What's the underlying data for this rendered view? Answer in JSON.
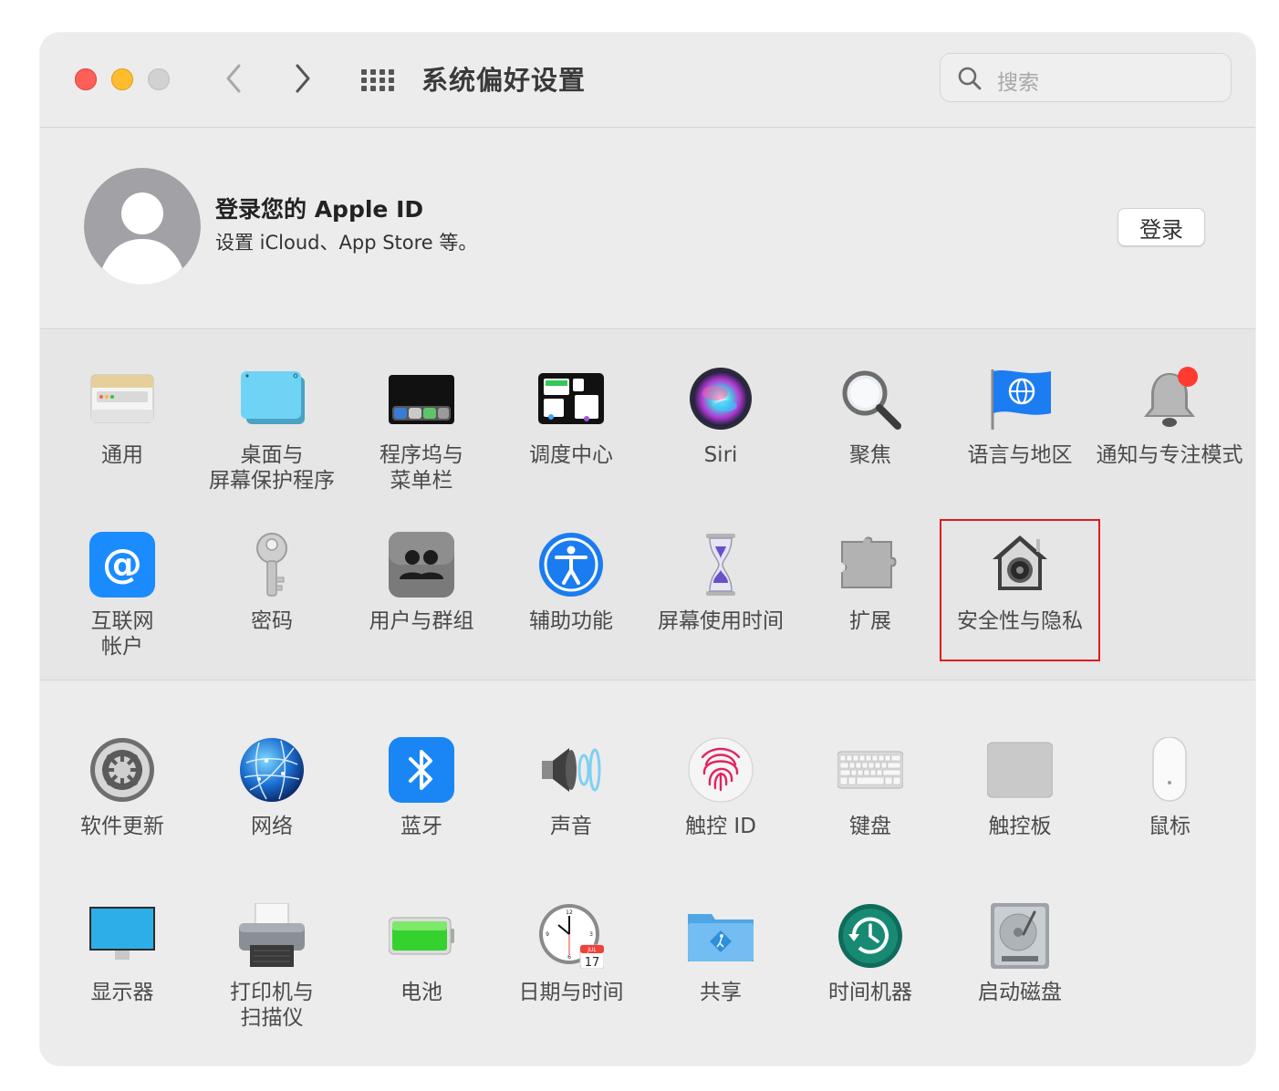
{
  "window": {
    "title": "系统偏好设置",
    "search_placeholder": "搜索"
  },
  "account": {
    "title": "登录您的 Apple ID",
    "subtitle": "设置 iCloud、App Store 等。",
    "login_button": "登录"
  },
  "panes_row1": [
    {
      "label": "通用",
      "icon": "general-icon"
    },
    {
      "label": "桌面与\n屏幕保护程序",
      "icon": "desktop-screensaver-icon"
    },
    {
      "label": "程序坞与\n菜单栏",
      "icon": "dock-menubar-icon"
    },
    {
      "label": "调度中心",
      "icon": "mission-control-icon"
    },
    {
      "label": "Siri",
      "icon": "siri-icon"
    },
    {
      "label": "聚焦",
      "icon": "spotlight-icon"
    },
    {
      "label": "语言与地区",
      "icon": "language-region-icon"
    },
    {
      "label": "通知与专注模式",
      "icon": "notifications-icon"
    }
  ],
  "panes_row2": [
    {
      "label": "互联网\n帐户",
      "icon": "internet-accounts-icon"
    },
    {
      "label": "密码",
      "icon": "passwords-icon"
    },
    {
      "label": "用户与群组",
      "icon": "users-groups-icon"
    },
    {
      "label": "辅助功能",
      "icon": "accessibility-icon"
    },
    {
      "label": "屏幕使用时间",
      "icon": "screen-time-icon"
    },
    {
      "label": "扩展",
      "icon": "extensions-icon"
    },
    {
      "label": "安全性与隐私",
      "icon": "security-privacy-icon"
    }
  ],
  "panes_row3": [
    {
      "label": "软件更新",
      "icon": "software-update-icon"
    },
    {
      "label": "网络",
      "icon": "network-icon"
    },
    {
      "label": "蓝牙",
      "icon": "bluetooth-icon"
    },
    {
      "label": "声音",
      "icon": "sound-icon"
    },
    {
      "label": "触控 ID",
      "icon": "touch-id-icon"
    },
    {
      "label": "键盘",
      "icon": "keyboard-icon"
    },
    {
      "label": "触控板",
      "icon": "trackpad-icon"
    },
    {
      "label": "鼠标",
      "icon": "mouse-icon"
    }
  ],
  "panes_row4": [
    {
      "label": "显示器",
      "icon": "displays-icon"
    },
    {
      "label": "打印机与\n扫描仪",
      "icon": "printers-scanners-icon"
    },
    {
      "label": "电池",
      "icon": "battery-icon"
    },
    {
      "label": "日期与时间",
      "icon": "date-time-icon"
    },
    {
      "label": "共享",
      "icon": "sharing-icon"
    },
    {
      "label": "时间机器",
      "icon": "time-machine-icon"
    },
    {
      "label": "启动磁盘",
      "icon": "startup-disk-icon"
    }
  ],
  "date_time_icon": {
    "month": "JUL",
    "day": "17"
  },
  "highlighted_pane": "安全性与隐私",
  "colors": {
    "highlight_border": "#e01b1b",
    "close": "#fe5f57",
    "minimize": "#febc2e"
  }
}
